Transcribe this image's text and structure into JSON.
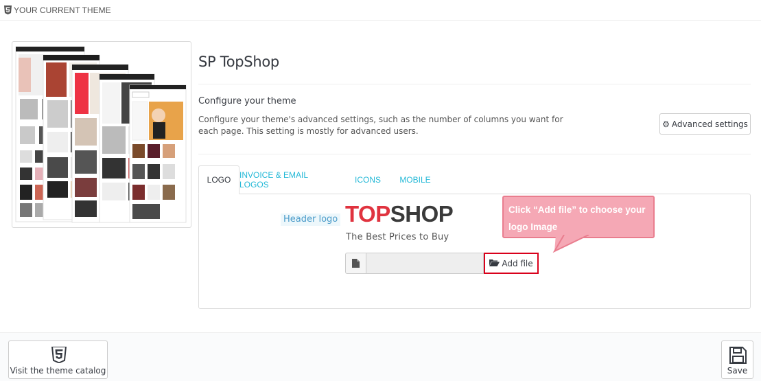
{
  "header": {
    "title": "YOUR CURRENT THEME",
    "icon": "html5-icon"
  },
  "theme": {
    "name": "SP TopShop"
  },
  "config": {
    "title": "Configure your theme",
    "description": "Configure your theme's advanced settings, such as the number of columns you want for each page. This setting is mostly for advanced users.",
    "advanced_button": "Advanced settings"
  },
  "tabs": [
    {
      "label": "LOGO",
      "active": true
    },
    {
      "label": "INVOICE & EMAIL LOGOS",
      "active": false
    },
    {
      "label": "ICONS",
      "active": false
    },
    {
      "label": "MOBILE",
      "active": false
    }
  ],
  "logo_tab": {
    "header_logo_label": "Header logo",
    "logo_top": "TOP",
    "logo_shop": "SHOP",
    "logo_tagline": "The Best Prices to Buy",
    "file_value": "",
    "add_file_label": "Add file"
  },
  "callout": {
    "text": "Click “Add file” to choose your logo Image"
  },
  "footer": {
    "catalog_button": "Visit the theme catalog",
    "save_button": "Save"
  },
  "colors": {
    "accent": "#25b9d7",
    "logo_red": "#e0333f",
    "highlight_border": "#d9001b",
    "callout_bg": "#f5a8b5"
  }
}
